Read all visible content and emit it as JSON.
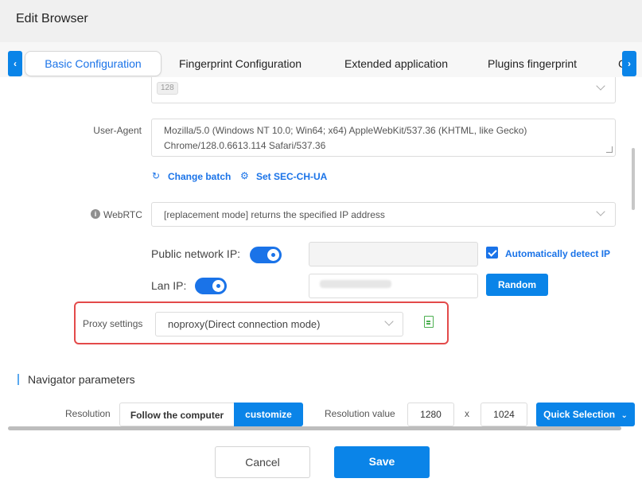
{
  "window": {
    "title": "Edit Browser"
  },
  "tabs": [
    {
      "label": "Basic Configuration",
      "active": true
    },
    {
      "label": "Fingerprint Configuration",
      "active": false
    },
    {
      "label": "Extended application",
      "active": false
    },
    {
      "label": "Plugins fingerprint",
      "active": false
    },
    {
      "label": "C",
      "active": false
    }
  ],
  "nav": {
    "prev_icon": "‹",
    "next_icon": "›"
  },
  "kernel": {
    "chip_text": "128"
  },
  "user_agent": {
    "label": "User-Agent",
    "value": "Mozilla/5.0 (Windows NT 10.0; Win64; x64) AppleWebKit/537.36 (KHTML, like Gecko) Chrome/128.0.6613.114 Safari/537.36",
    "change_batch": "Change batch",
    "set_sec_ch_ua": "Set SEC-CH-UA"
  },
  "webrtc": {
    "label": "WebRTC",
    "value": "[replacement mode] returns the specified IP address",
    "public_ip_label": "Public network IP:",
    "public_ip_enabled": true,
    "public_ip_value": "",
    "auto_detect_label": "Automatically detect IP",
    "auto_detect_checked": true,
    "lan_ip_label": "Lan IP:",
    "lan_ip_enabled": true,
    "random_label": "Random"
  },
  "proxy": {
    "label": "Proxy settings",
    "value": "noproxy(Direct connection mode)"
  },
  "navigator": {
    "section_title": "Navigator parameters",
    "resolution_label": "Resolution",
    "follow_label": "Follow the computer",
    "customize_label": "customize",
    "resolution_value_label": "Resolution value",
    "width": "1280",
    "separator": "x",
    "height": "1024",
    "quick_selection": "Quick Selection"
  },
  "footer": {
    "cancel": "Cancel",
    "save": "Save"
  },
  "colors": {
    "accent": "#0a84e8",
    "highlight": "#e34a4a",
    "doc_icon": "#4caf50"
  }
}
